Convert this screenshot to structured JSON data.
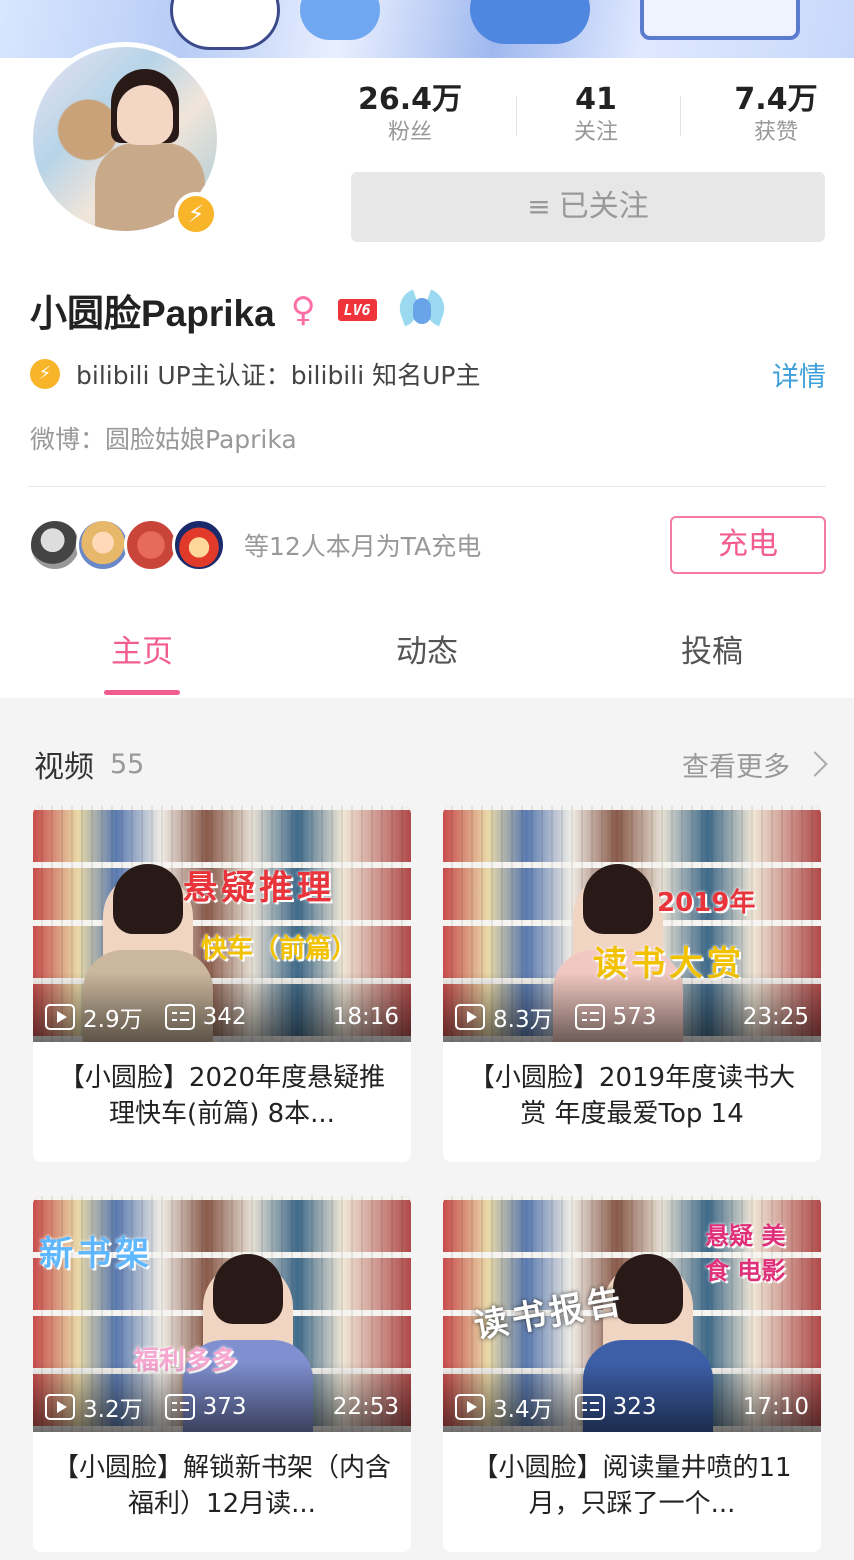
{
  "profile": {
    "stats": [
      {
        "value": "26.4万",
        "label": "粉丝"
      },
      {
        "value": "41",
        "label": "关注"
      },
      {
        "value": "7.4万",
        "label": "获赞"
      }
    ],
    "follow_button": {
      "icon": "menu-icon",
      "label": "已关注"
    },
    "name": "小圆脸Paprika",
    "gender_icon": "female-icon",
    "level": "LV6",
    "verify_text": "bilibili UP主认证：bilibili 知名UP主",
    "detail_link": "详情",
    "weibo_label": "微博：",
    "weibo_value": "圆脸姑娘Paprika",
    "charge_text": "等12人本月为TA充电",
    "charge_button": "充电"
  },
  "tabs": [
    "主页",
    "动态",
    "投稿"
  ],
  "videos_section": {
    "title": "视频",
    "count": "55",
    "more": "查看更多"
  },
  "videos": [
    {
      "overlay_title": "悬疑推理",
      "overlay_sub": "快车（前篇）",
      "views": "2.9万",
      "danmaku": "342",
      "duration": "18:16",
      "title": "【小圆脸】2020年度悬疑推理快车(前篇) 8本..."
    },
    {
      "overlay_title": "读书大赏",
      "overlay_sub": "2019年",
      "views": "8.3万",
      "danmaku": "573",
      "duration": "23:25",
      "title": "【小圆脸】2019年度读书大赏 年度最爱Top 14"
    },
    {
      "overlay_title": "新书架",
      "overlay_sub": "福利多多",
      "views": "3.2万",
      "danmaku": "373",
      "duration": "22:53",
      "title": "【小圆脸】解锁新书架（内含福利）12月读..."
    },
    {
      "overlay_title": "读书报告",
      "overlay_sub": "悬疑 美食 电影",
      "views": "3.4万",
      "danmaku": "323",
      "duration": "17:10",
      "title": "【小圆脸】阅读量井喷的11月，只踩了一个..."
    }
  ],
  "colors": {
    "accent_pink": "#f25d8e",
    "link_blue": "#3ea0d8",
    "verify_gold": "#f9b52a"
  }
}
